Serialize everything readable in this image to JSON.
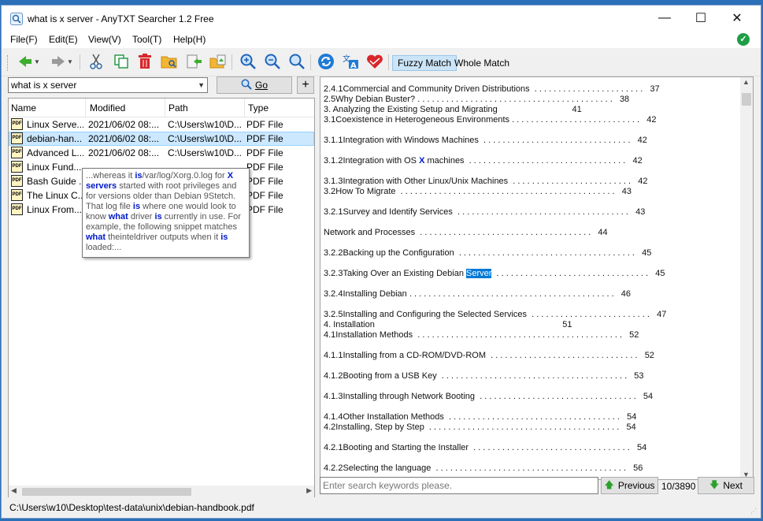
{
  "window": {
    "title": "what is x server - AnyTXT Searcher 1.2 Free",
    "minimize_glyph": "—",
    "maximize_glyph": "☐",
    "close_glyph": "✕"
  },
  "menu": [
    "File(F)",
    "Edit(E)",
    "View(V)",
    "Tool(T)",
    "Help(H)"
  ],
  "toolbar": {
    "fuzzy_label": "Fuzzy Match",
    "whole_label": "Whole Match",
    "icons": [
      "back-icon",
      "forward-icon",
      "cut-icon",
      "copy-icon",
      "delete-icon",
      "open-folder-icon",
      "export-icon",
      "export-folder-icon",
      "zoom-in-icon",
      "zoom-out-icon",
      "search-icon",
      "refresh-icon",
      "translate-icon",
      "favorite-icon"
    ]
  },
  "search": {
    "query": "what is x server",
    "go_label": "Go",
    "plus_label": "+"
  },
  "list": {
    "columns": [
      "Name",
      "Modified",
      "Path",
      "Type"
    ],
    "rows": [
      {
        "name": "Linux Serve...",
        "modified": "2021/06/02  08:...",
        "path": "C:\\Users\\w10\\D...",
        "type": "PDF File"
      },
      {
        "name": "debian-han...",
        "modified": "2021/06/02  08:...",
        "path": "C:\\Users\\w10\\D...",
        "type": "PDF File"
      },
      {
        "name": "Advanced L...",
        "modified": "2021/06/02  08:...",
        "path": "C:\\Users\\w10\\D...",
        "type": "PDF File"
      },
      {
        "name": "Linux Fund...",
        "modified": "",
        "path": "",
        "type": "PDF File"
      },
      {
        "name": "Bash Guide ...",
        "modified": "",
        "path": "",
        "type": "PDF File"
      },
      {
        "name": "The Linux C...",
        "modified": "",
        "path": "",
        "type": "PDF File"
      },
      {
        "name": "Linux From...",
        "modified": "",
        "path": "",
        "type": "PDF File"
      }
    ],
    "icon_text": "PDF"
  },
  "tooltip": {
    "segments": [
      [
        "...whereas it ",
        false
      ],
      [
        "is",
        true
      ],
      [
        "/var/log/Xorg.0.log for ",
        false
      ],
      [
        "X",
        true
      ],
      [
        " ",
        false
      ],
      [
        "servers",
        true
      ],
      [
        " started with root privileges and for versions older than Debian 9Stetch. That log file ",
        false
      ],
      [
        "is",
        true
      ],
      [
        " where one would look to know ",
        false
      ],
      [
        "what",
        true
      ],
      [
        " driver ",
        false
      ],
      [
        "is",
        true
      ],
      [
        " currently in use. For example, the following snippet matches ",
        false
      ],
      [
        "what",
        true
      ],
      [
        " theinteldriver outputs when it ",
        false
      ],
      [
        "is",
        true
      ],
      [
        " loaded:...",
        false
      ]
    ]
  },
  "document": {
    "lines": [
      {
        "text": "2.4.1Commercial and Community Driven Distributions  . . . . . . . . . . . . . . . . . . . . . . .   37"
      },
      {
        "text": "2.5Why Debian Buster? . . . . . . . . . . . . . . . . . . . . . . . . . . . . . . . . . . . . . . . . .   38"
      },
      {
        "text": "3. Analyzing the Existing Setup and Migrating                               41"
      },
      {
        "text": "3.1Coexistence in Heterogeneous Environments . . . . . . . . . . . . . . . . . . . . . . . . . . .   42"
      },
      {
        "text": "3.1.1Integration with Windows Machines  . . . . . . . . . . . . . . . . . . . . . . . . . . . . . . .   42"
      },
      {
        "text": "3.1.2Integration with OS ",
        "mark": "X",
        "after": " machines  . . . . . . . . . . . . . . . . . . . . . . . . . . . . . . . . .   42"
      },
      {
        "text": "3.1.3Integration with Other Linux/Unix Machines  . . . . . . . . . . . . . . . . . . . . . . . . .   42"
      },
      {
        "text": "3.2How To Migrate  . . . . . . . . . . . . . . . . . . . . . . . . . . . . . . . . . . . . . . . . . . . . .   43"
      },
      {
        "text": "3.2.1Survey and Identify Services  . . . . . . . . . . . . . . . . . . . . . . . . . . . . . . . . . . . .   43"
      },
      {
        "text": "Network and Processes  . . . . . . . . . . . . . . . . . . . . . . . . . . . . . . . . . . . .   44"
      },
      {
        "text": "3.2.2Backing up the Configuration  . . . . . . . . . . . . . . . . . . . . . . . . . . . . . . . . . . . . .   45"
      },
      {
        "text": "3.2.3Taking Over an Existing Debian ",
        "sel": "Server",
        "after": "  . . . . . . . . . . . . . . . . . . . . . . . . . . . . . . . .   45"
      },
      {
        "text": "3.2.4Installing Debian . . . . . . . . . . . . . . . . . . . . . . . . . . . . . . . . . . . . . . . . . . .   46"
      },
      {
        "text": "3.2.5Installing and Configuring the Selected Services  . . . . . . . . . . . . . . . . . . . . . . . . .   47"
      },
      {
        "text": "4. Installation                                                                              51"
      },
      {
        "text": "4.1Installation Methods  . . . . . . . . . . . . . . . . . . . . . . . . . . . . . . . . . . . . . . . . . . .   52"
      },
      {
        "text": "4.1.1Installing from a CD-ROM/DVD-ROM  . . . . . . . . . . . . . . . . . . . . . . . . . . . . . . .   52"
      },
      {
        "text": "4.1.2Booting from a USB Key  . . . . . . . . . . . . . . . . . . . . . . . . . . . . . . . . . . . . . . .   53"
      },
      {
        "text": "4.1.3Installing through Network Booting  . . . . . . . . . . . . . . . . . . . . . . . . . . . . . . . . .   54"
      },
      {
        "text": "4.1.4Other Installation Methods  . . . . . . . . . . . . . . . . . . . . . . . . . . . . . . . . . . . .   54"
      },
      {
        "text": "4.2Installing, Step by Step  . . . . . . . . . . . . . . . . . . . . . . . . . . . . . . . . . . . . . . . .   54"
      },
      {
        "text": "4.2.1Booting and Starting the Installer  . . . . . . . . . . . . . . . . . . . . . . . . . . . . . . . . .   54"
      },
      {
        "text": "4.2.2Selecting the language  . . . . . . . . . . . . . . . . . . . . . . . . . . . . . . . . . . . . . . . .   56"
      }
    ]
  },
  "bottom": {
    "placeholder": "Enter search keywords please.",
    "prev_label": "Previous",
    "counter": "10/3890",
    "next_label": "Next"
  },
  "status": {
    "path": "C:\\Users\\w10\\Desktop\\test-data\\unix\\debian-handbook.pdf"
  },
  "colors": {
    "highlight": "#0078d7",
    "match": "#0019c8",
    "ok": "#1d9e46"
  }
}
